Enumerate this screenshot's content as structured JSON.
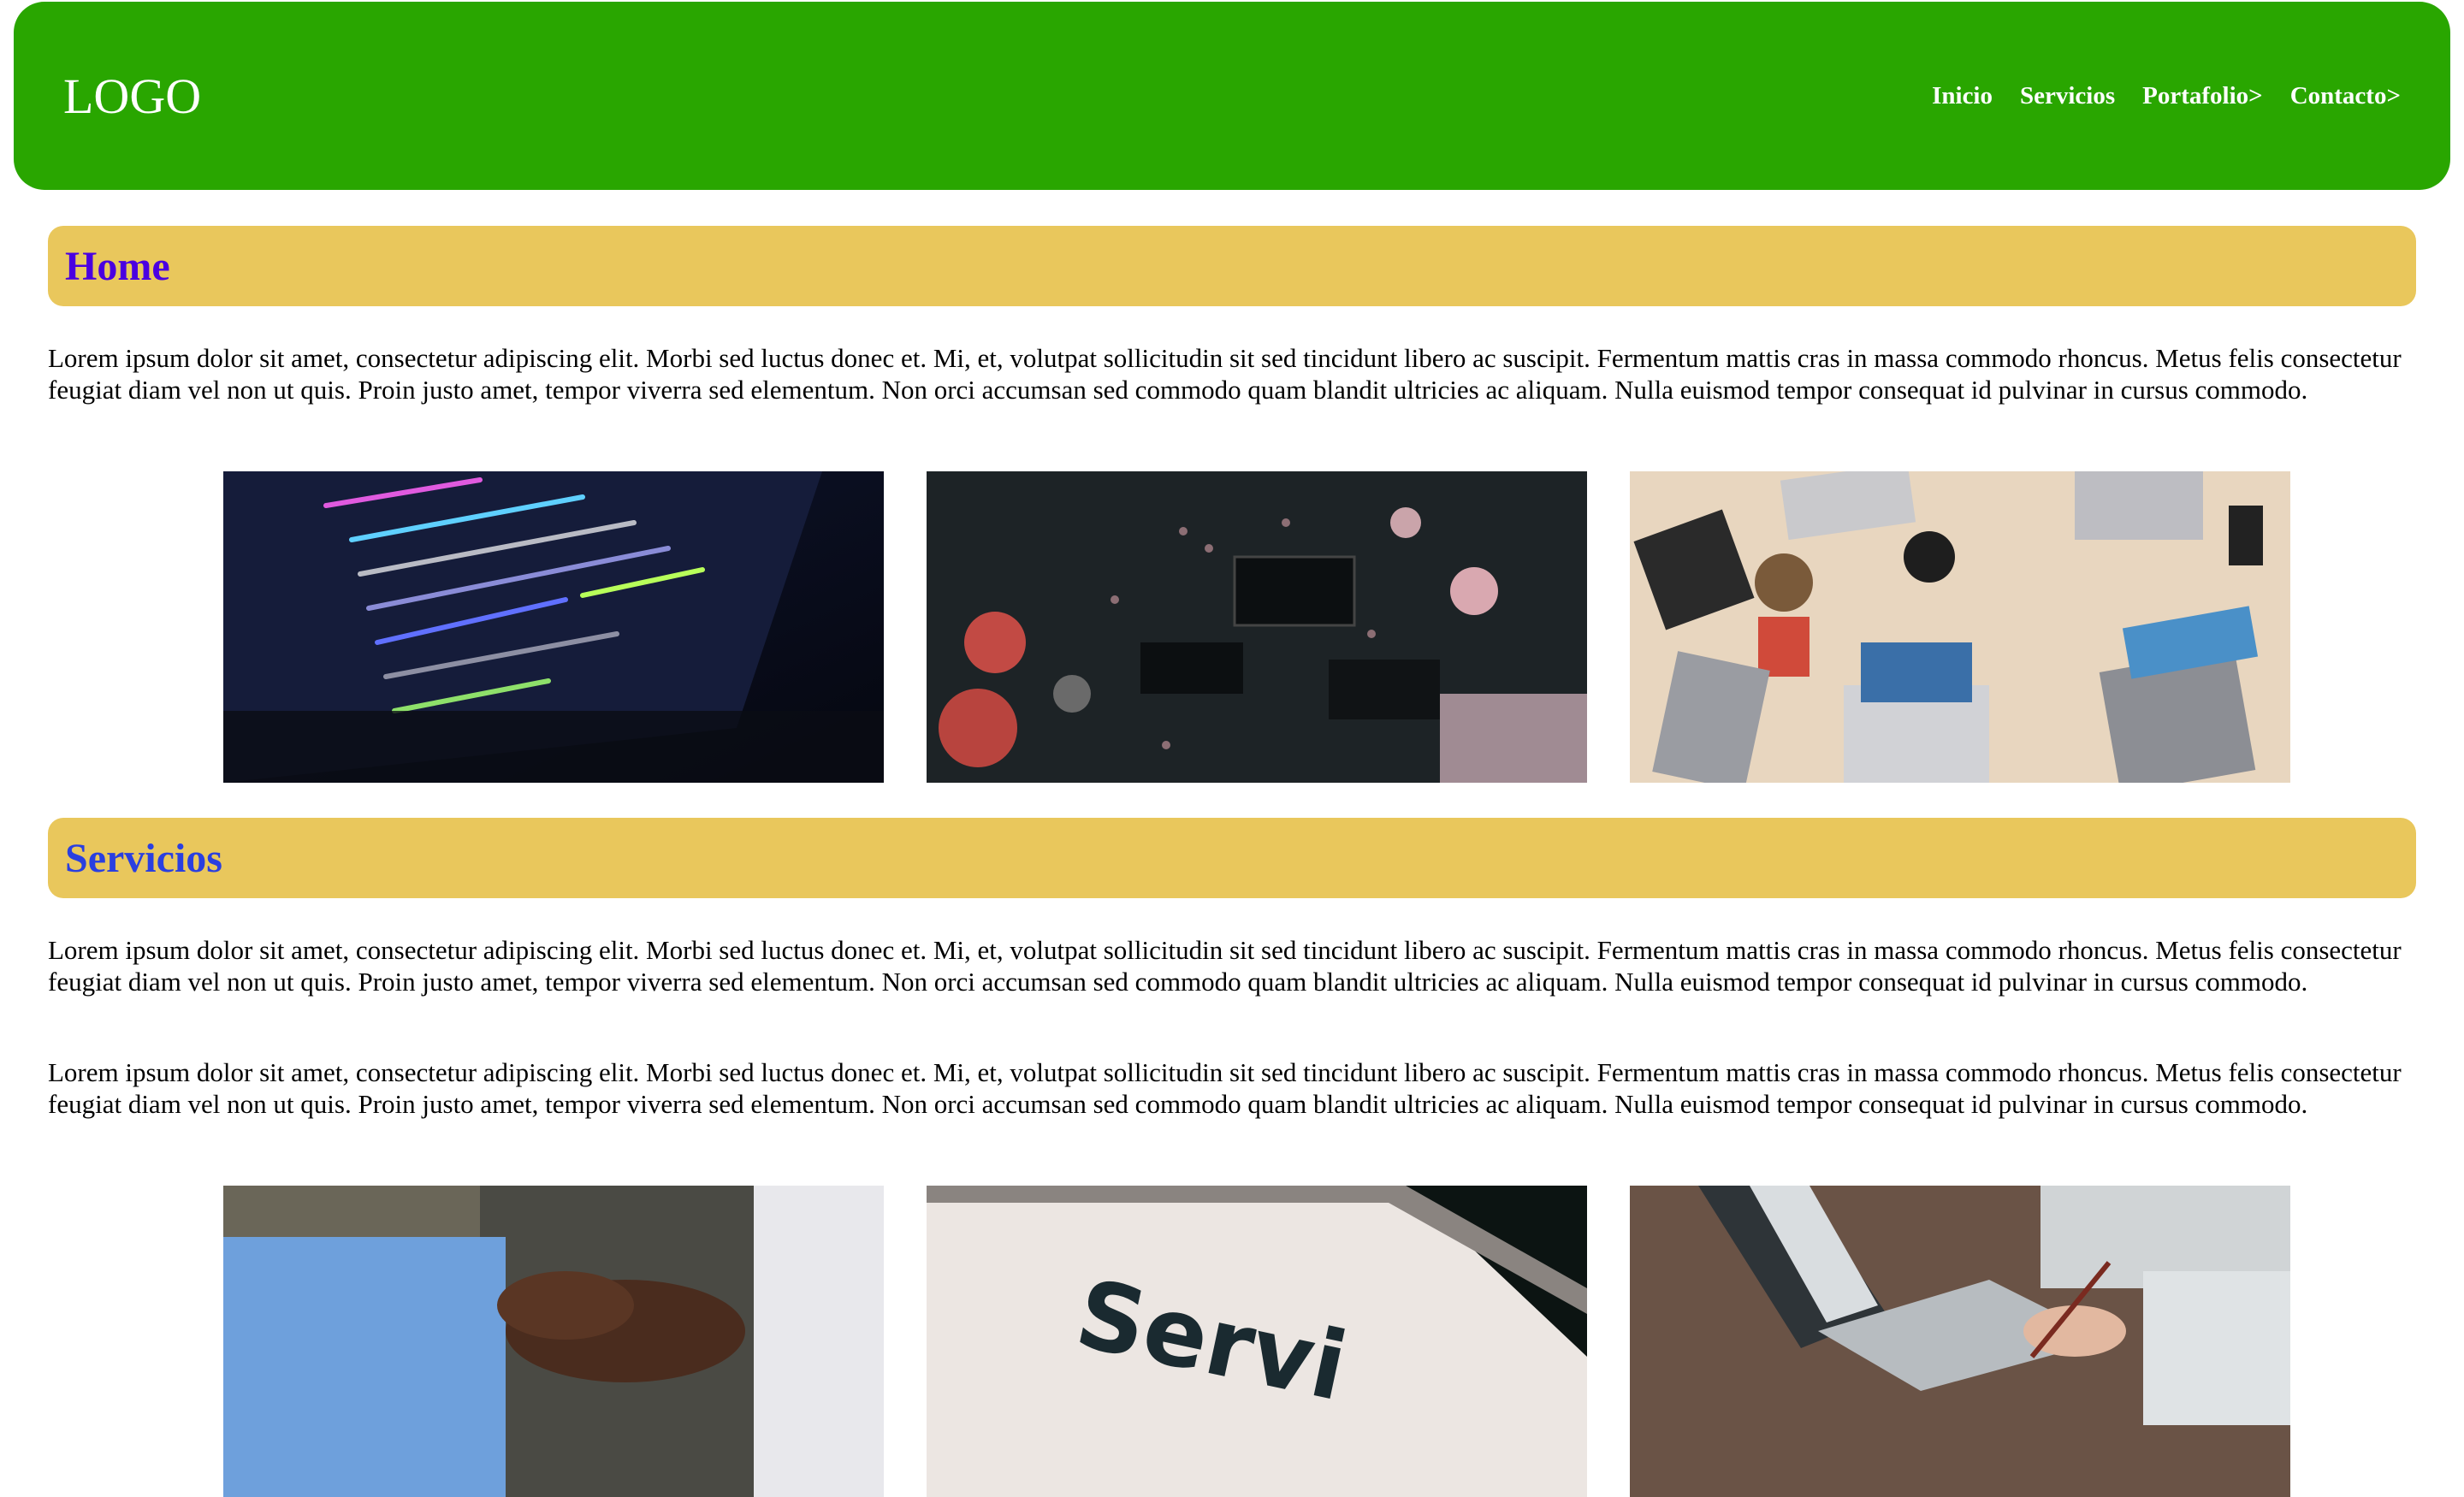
{
  "header": {
    "logo": "LOGO",
    "nav": [
      {
        "label": "Inicio"
      },
      {
        "label": "Servicios"
      },
      {
        "label": "Portafolio>"
      },
      {
        "label": "Contacto>"
      }
    ],
    "colors": {
      "background": "#29a600",
      "text": "#ffffff"
    }
  },
  "sections": [
    {
      "title": "Home",
      "title_color": "#4a00e0",
      "paragraphs": [
        "Lorem ipsum dolor sit amet, consectetur adipiscing elit. Morbi sed luctus donec et. Mi, et, volutpat sollicitudin sit sed tincidunt libero ac suscipit. Fermentum mattis cras in massa commodo rhoncus. Metus felis consectetur feugiat diam vel non ut quis. Proin justo amet, tempor viverra sed elementum. Non orci accumsan sed commodo quam blandit ultricies ac aliquam. Nulla euismod tempor consequat id pulvinar in cursus commodo."
      ],
      "images": [
        "code-laptop-image",
        "circuit-board-image",
        "team-laptops-table-image"
      ]
    },
    {
      "title": "Servicios",
      "title_color": "#2a3fe0",
      "paragraphs": [
        "Lorem ipsum dolor sit amet, consectetur adipiscing elit. Morbi sed luctus donec et. Mi, et, volutpat sollicitudin sit sed tincidunt libero ac suscipit. Fermentum mattis cras in massa commodo rhoncus. Metus felis consectetur feugiat diam vel non ut quis. Proin justo amet, tempor viverra sed elementum. Non orci accumsan sed commodo quam blandit ultricies ac aliquam. Nulla euismod tempor consequat id pulvinar in cursus commodo.",
        "Lorem ipsum dolor sit amet, consectetur adipiscing elit. Morbi sed luctus donec et. Mi, et, volutpat sollicitudin sit sed tincidunt libero ac suscipit. Fermentum mattis cras in massa commodo rhoncus. Metus felis consectetur feugiat diam vel non ut quis. Proin justo amet, tempor viverra sed elementum. Non orci accumsan sed commodo quam blandit ultricies ac aliquam. Nulla euismod tempor consequat id pulvinar in cursus commodo."
      ],
      "images": [
        "handshake-image",
        "servi-sign-image",
        "laptop-writing-image"
      ],
      "image_text": "Servi"
    }
  ],
  "section_bar_color": "#e9c75c"
}
